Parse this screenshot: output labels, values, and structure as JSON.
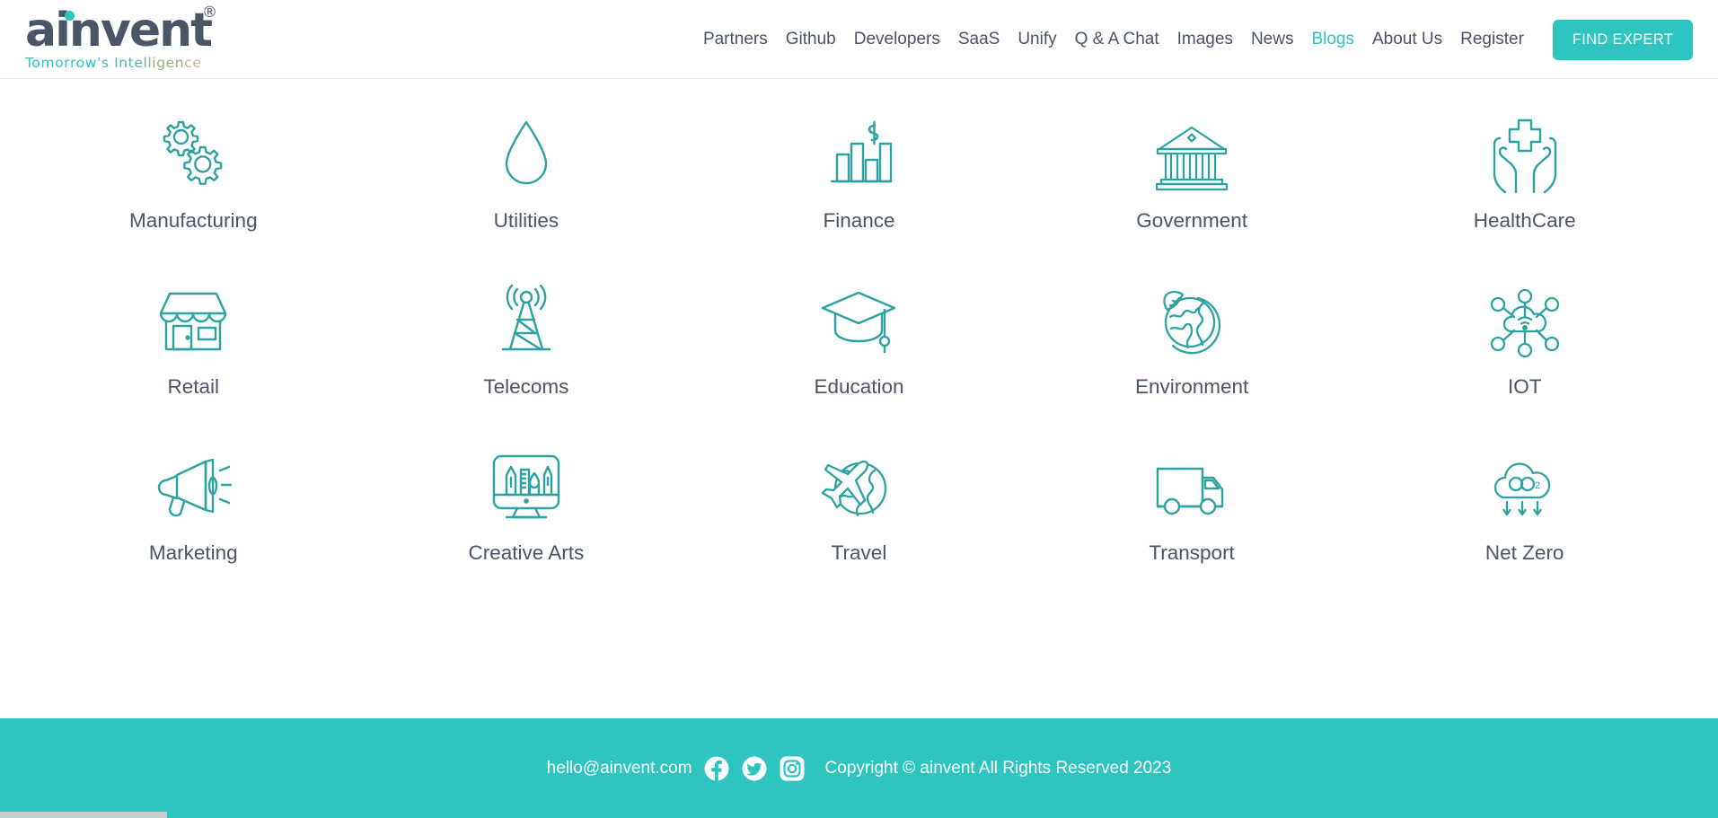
{
  "brand": {
    "name": "ainvent",
    "trademark": "®",
    "tagline_parts": [
      "Tomorrow",
      "'s Intel",
      "ligen",
      "ce"
    ],
    "tagline": "Tomorrow's Intelligence",
    "accent_color": "#2ec4c0",
    "text_color": "#4a5568"
  },
  "nav": {
    "items": [
      {
        "label": "Partners",
        "active": false
      },
      {
        "label": "Github",
        "active": false
      },
      {
        "label": "Developers",
        "active": false
      },
      {
        "label": "SaaS",
        "active": false
      },
      {
        "label": "Unify",
        "active": false
      },
      {
        "label": "Q & A Chat",
        "active": false
      },
      {
        "label": "Images",
        "active": false
      },
      {
        "label": "News",
        "active": false
      },
      {
        "label": "Blogs",
        "active": true
      },
      {
        "label": "About Us",
        "active": false
      },
      {
        "label": "Register",
        "active": false
      }
    ],
    "cta_label": "FIND EXPERT"
  },
  "categories": [
    {
      "label": "Manufacturing",
      "icon": "gears-icon"
    },
    {
      "label": "Utilities",
      "icon": "water-drop-icon"
    },
    {
      "label": "Finance",
      "icon": "bar-chart-dollar-icon"
    },
    {
      "label": "Government",
      "icon": "bank-building-icon"
    },
    {
      "label": "HealthCare",
      "icon": "hands-cross-icon"
    },
    {
      "label": "Retail",
      "icon": "storefront-icon"
    },
    {
      "label": "Telecoms",
      "icon": "radio-tower-icon"
    },
    {
      "label": "Education",
      "icon": "graduation-cap-icon"
    },
    {
      "label": "Environment",
      "icon": "globe-leaf-icon"
    },
    {
      "label": "IOT",
      "icon": "cloud-network-icon"
    },
    {
      "label": "Marketing",
      "icon": "megaphone-icon"
    },
    {
      "label": "Creative Arts",
      "icon": "monitor-art-tools-icon"
    },
    {
      "label": "Travel",
      "icon": "airplane-globe-icon"
    },
    {
      "label": "Transport",
      "icon": "delivery-truck-icon"
    },
    {
      "label": "Net Zero",
      "icon": "co2-cloud-icon"
    }
  ],
  "footer": {
    "email": "hello@ainvent.com",
    "social": [
      "facebook-icon",
      "twitter-icon",
      "instagram-icon"
    ],
    "copyright": "Copyright © ainvent All Rights Reserved 2023",
    "background_color": "#2ec4c0"
  }
}
